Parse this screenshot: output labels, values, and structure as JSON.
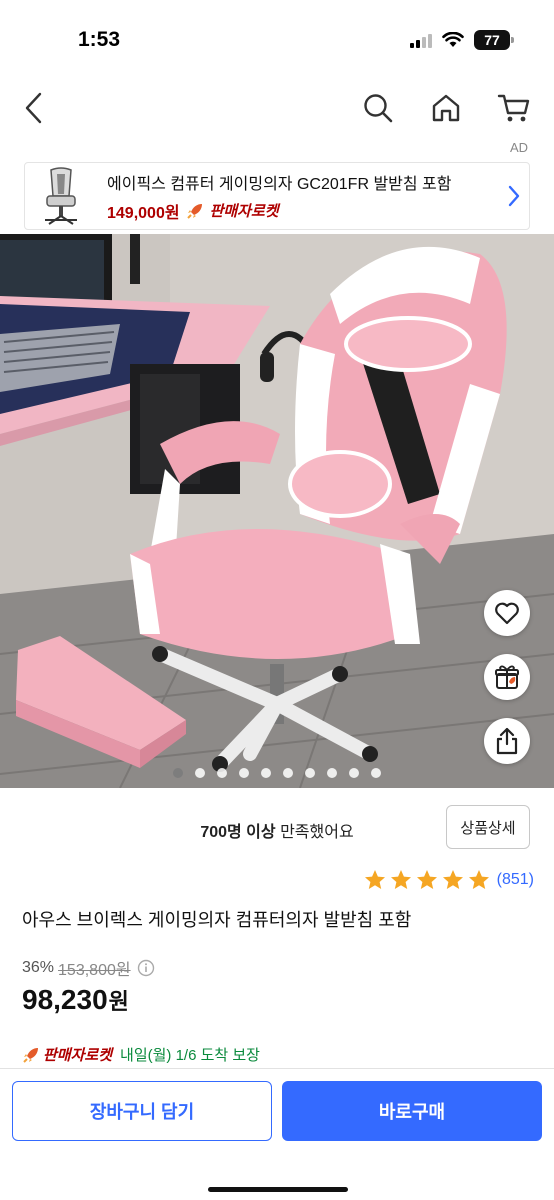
{
  "status_bar": {
    "time": "1:53",
    "battery": "77"
  },
  "nav": {
    "ad_label": "AD"
  },
  "ad_banner": {
    "title": "에이픽스 컴퓨터 게이밍의자 GC201FR 발받침 포함",
    "price": "149,000원",
    "rocket_label": "판매자로켓"
  },
  "gallery": {
    "image_count": 10,
    "active_index": 0
  },
  "info": {
    "satisfaction_bold": "700명 이상",
    "satisfaction_rest": " 만족했어요",
    "detail_button": "상품상세",
    "rating": 5,
    "review_count": "(851)",
    "title": "아우스 브이렉스 게이밍의자 컴퓨터의자 발받침 포함",
    "discount": "36%",
    "original_price": "153,800원",
    "price": "98,230",
    "currency": "원",
    "rocket_label": "판매자로켓",
    "delivery": "내일(월) 1/6 도착 보장"
  },
  "buttons": {
    "cart": "장바구니 담기",
    "buy": "바로구매"
  },
  "colors": {
    "accent": "#346aff",
    "price_red": "#ae0000",
    "delivery_green": "#0a8a3c",
    "star": "#f5a623"
  }
}
